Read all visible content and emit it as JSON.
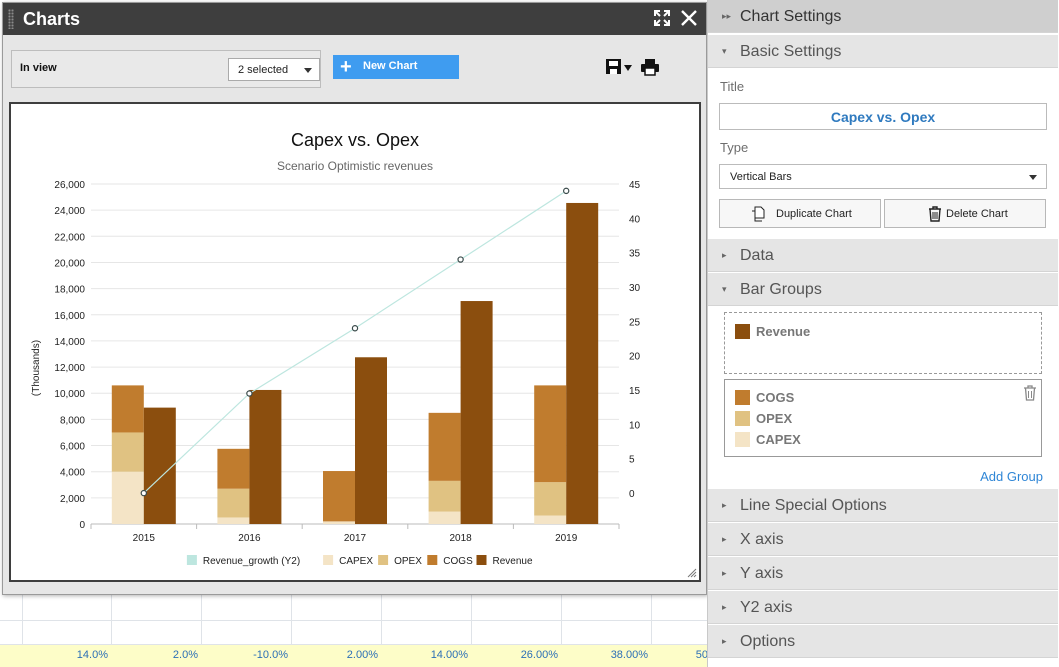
{
  "dialog": {
    "title": "Charts",
    "in_view_label": "In view",
    "selection_value": "2 selected",
    "new_chart_label": "New Chart"
  },
  "spreadsheet": {
    "percent_row": [
      "14.0%",
      "2.0%",
      "-10.0%",
      "2.00%",
      "14.00%",
      "26.00%",
      "38.00%",
      "50"
    ]
  },
  "panel": {
    "header_title": "Chart Settings",
    "basic_settings_title": "Basic Settings",
    "title_label": "Title",
    "title_value": "Capex vs. Opex",
    "type_label": "Type",
    "type_value": "Vertical Bars",
    "duplicate_label": "Duplicate Chart",
    "delete_label": "Delete Chart",
    "data_title": "Data",
    "bar_groups_title": "Bar Groups",
    "group1": [
      {
        "label": "Revenue",
        "color": "#8B4E0E"
      }
    ],
    "group2": [
      {
        "label": "COGS",
        "color": "#C07C2E"
      },
      {
        "label": "OPEX",
        "color": "#E0C282"
      },
      {
        "label": "CAPEX",
        "color": "#F4E4C6"
      }
    ],
    "add_group_label": "Add Group",
    "line_special_title": "Line Special Options",
    "x_axis_title": "X axis",
    "y_axis_title": "Y axis",
    "y2_axis_title": "Y2 axis",
    "options_title": "Options"
  },
  "chart_data": {
    "type": "bar",
    "title": "Capex vs. Opex",
    "subtitle": "Scenario Optimistic revenues",
    "ylabel": "(Thousands)",
    "categories": [
      "2015",
      "2016",
      "2017",
      "2018",
      "2019"
    ],
    "ylim": [
      0,
      26000
    ],
    "yticks": [
      0,
      2000,
      4000,
      6000,
      8000,
      10000,
      12000,
      14000,
      16000,
      18000,
      20000,
      22000,
      24000,
      26000
    ],
    "y2lim": [
      -4.5,
      45
    ],
    "y2ticks": [
      0,
      5,
      10,
      15,
      20,
      25,
      30,
      35,
      40,
      45
    ],
    "stacked_series": [
      {
        "name": "CAPEX",
        "color": "#F4E4C6",
        "values": [
          4000,
          500,
          200,
          950,
          650
        ]
      },
      {
        "name": "OPEX",
        "color": "#E0C282",
        "values": [
          3000,
          2200,
          0,
          2350,
          2550
        ]
      },
      {
        "name": "COGS",
        "color": "#C07C2E",
        "values": [
          3600,
          3050,
          3850,
          5200,
          7400
        ]
      }
    ],
    "bar_series": [
      {
        "name": "Revenue",
        "color": "#8B4E0E",
        "values": [
          8900,
          10250,
          12750,
          17050,
          24550
        ]
      }
    ],
    "line_series": [
      {
        "name": "Revenue_growth (Y2)",
        "color": "#bde6df",
        "axis": "y2",
        "values": [
          0,
          14.5,
          24,
          34,
          44
        ]
      }
    ],
    "legend": [
      "Revenue_growth (Y2)",
      "CAPEX",
      "OPEX",
      "COGS",
      "Revenue"
    ],
    "legend_position": "bottom",
    "grid": true
  }
}
